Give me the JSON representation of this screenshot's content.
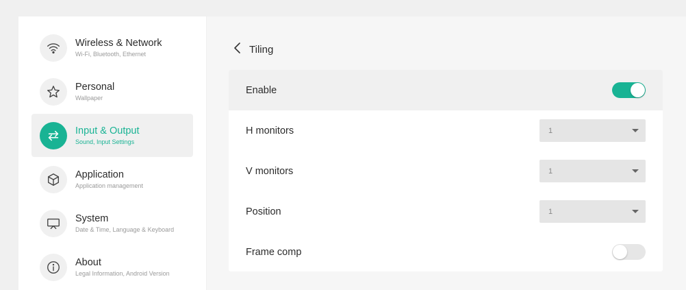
{
  "sidebar": {
    "items": [
      {
        "title": "Wireless & Network",
        "subtitle": "Wi-Fi, Bluetooth, Ethernet",
        "icon": "wifi-icon"
      },
      {
        "title": "Personal",
        "subtitle": "Wallpaper",
        "icon": "star-icon"
      },
      {
        "title": "Input & Output",
        "subtitle": "Sound, Input Settings",
        "icon": "swap-arrows-icon",
        "active": true
      },
      {
        "title": "Application",
        "subtitle": "Application management",
        "icon": "cube-icon"
      },
      {
        "title": "System",
        "subtitle": "Date & Time, Language & Keyboard",
        "icon": "presentation-screen-icon"
      },
      {
        "title": "About",
        "subtitle": "Legal Information, Android Version",
        "icon": "info-icon"
      }
    ]
  },
  "header": {
    "title": "Tiling",
    "back_icon": "chevron-left-icon"
  },
  "settings": {
    "enable": {
      "label": "Enable",
      "state": "on"
    },
    "h_monitors": {
      "label": "H monitors",
      "value": "1"
    },
    "v_monitors": {
      "label": "V monitors",
      "value": "1"
    },
    "position": {
      "label": "Position",
      "value": "1"
    },
    "frame_comp": {
      "label": "Frame comp",
      "state": "off"
    }
  },
  "colors": {
    "accent": "#19b394",
    "background": "#f0f0f0",
    "panel": "#ffffff"
  }
}
